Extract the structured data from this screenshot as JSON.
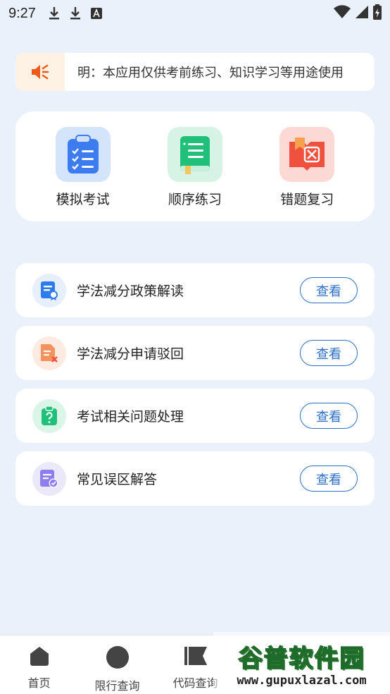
{
  "status_bar": {
    "time": "9:27"
  },
  "notice": {
    "text": "明：本应用仅供考前练习、知识学习等用途使用"
  },
  "quick_actions": [
    {
      "label": "模拟考试",
      "icon": "clipboard-checklist-icon",
      "color": "#3d7bf0"
    },
    {
      "label": "顺序练习",
      "icon": "green-book-icon",
      "color": "#21c07a"
    },
    {
      "label": "错题复习",
      "icon": "wrong-answer-book-icon",
      "color": "#f0513f"
    }
  ],
  "list": [
    {
      "title": "学法减分政策解读",
      "button": "查看",
      "icon": "policy-document-icon"
    },
    {
      "title": "学法减分申请驳回",
      "button": "查看",
      "icon": "rejected-document-icon"
    },
    {
      "title": "考试相关问题处理",
      "button": "查看",
      "icon": "question-clipboard-icon"
    },
    {
      "title": "常见误区解答",
      "button": "查看",
      "icon": "checked-document-icon"
    }
  ],
  "tabs": [
    {
      "label": "首页",
      "icon": "home-icon"
    },
    {
      "label": "限行查询",
      "icon": "circle-icon"
    },
    {
      "label": "代码查询",
      "icon": "flag-icon"
    }
  ],
  "watermark": {
    "title": "谷普软件园",
    "url": "www.gupuxlazal.com"
  },
  "colors": {
    "accent": "#2e6fc7",
    "background": "#eaf1fb",
    "notice_orange": "#f25a1d"
  }
}
